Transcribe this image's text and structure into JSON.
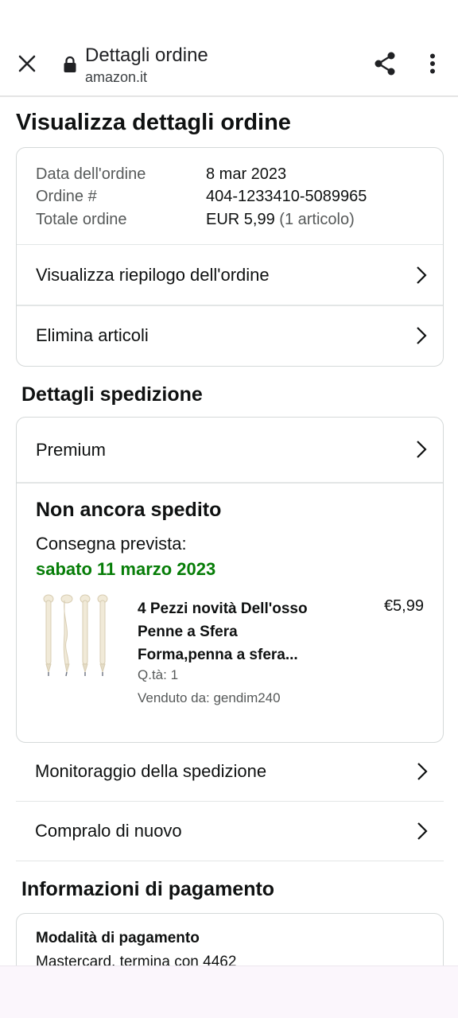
{
  "browser": {
    "title": "Dettagli ordine",
    "domain": "amazon.it"
  },
  "page": {
    "title": "Visualizza dettagli ordine"
  },
  "order_info": {
    "date_label": "Data dell'ordine",
    "date_value": "8 mar 2023",
    "number_label": "Ordine #",
    "number_value": "404-1233410-5089965",
    "total_label": "Totale ordine",
    "total_value": "EUR 5,99",
    "total_items": "(1 articolo)"
  },
  "order_links": {
    "summary": "Visualizza riepilogo dell'ordine",
    "delete": "Elimina articoli"
  },
  "shipping": {
    "section_title": "Dettagli spedizione",
    "method": "Premium",
    "status": "Non ancora spedito",
    "delivery_label": "Consegna prevista:",
    "delivery_date": "sabato 11 marzo 2023",
    "accent_color": "#067d07"
  },
  "product": {
    "title": "4 Pezzi novità Dell'osso Penne a Sfera Forma,penna a sfera...",
    "price": "€5,99",
    "qty": "Q.tà: 1",
    "seller": "Venduto da: gendim240"
  },
  "actions": {
    "track": "Monitoraggio della spedizione",
    "buy_again": "Compralo di nuovo"
  },
  "payment": {
    "section_title": "Informazioni di pagamento",
    "method_label": "Modalità di pagamento",
    "method_value": "Mastercard, termina con 4462"
  },
  "icons": {
    "close": "close-icon",
    "lock": "lock-icon",
    "share": "share-icon",
    "menu": "more-vert-icon",
    "chevron": "chevron-right-icon"
  }
}
